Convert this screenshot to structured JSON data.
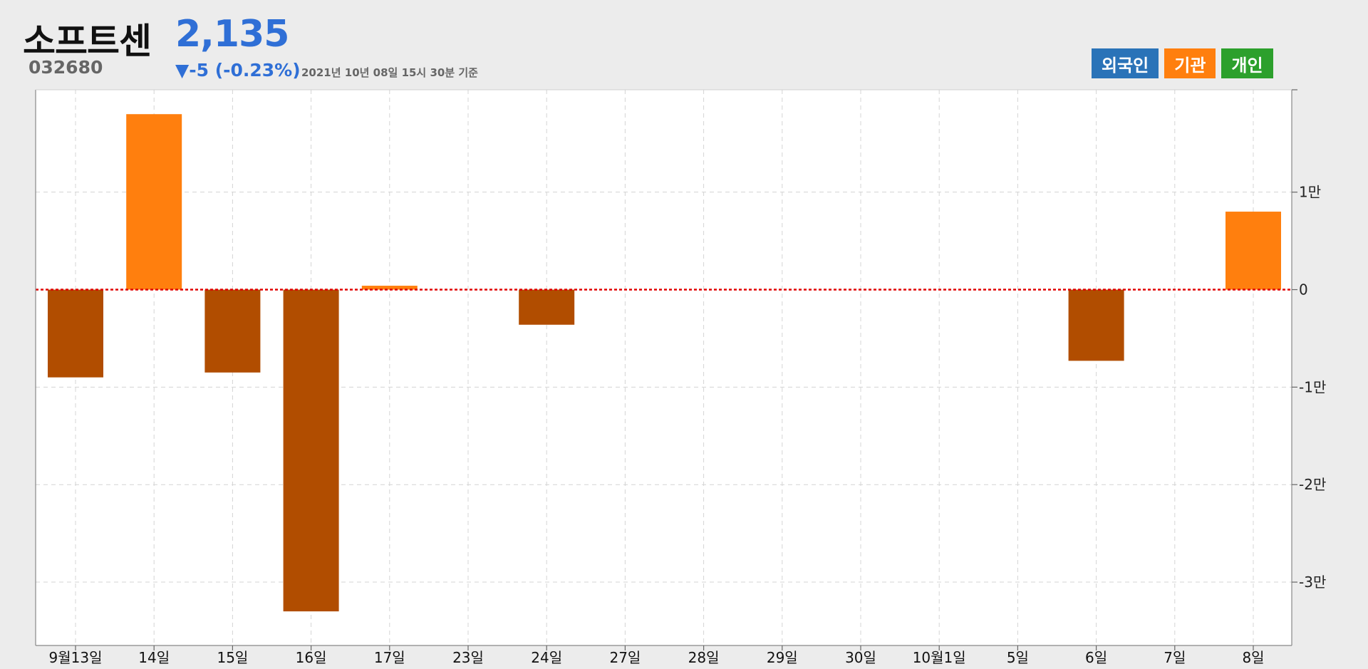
{
  "header": {
    "name": "소프트센",
    "code": "032680",
    "price": "2,135",
    "change": "▼-5 (-0.23%)",
    "timestamp": "2021년 10년 08일 15시 30분 기준"
  },
  "legend": {
    "foreign": {
      "label": "외국인",
      "color": "#2a73b8"
    },
    "institution": {
      "label": "기관",
      "color": "#ff7f0e"
    },
    "individual": {
      "label": "개인",
      "color": "#2ca02c"
    }
  },
  "chart_data": {
    "type": "bar",
    "categories": [
      "9월13일",
      "14일",
      "15일",
      "16일",
      "17일",
      "23일",
      "24일",
      "27일",
      "28일",
      "29일",
      "30일",
      "10월1일",
      "5일",
      "6일",
      "7일",
      "8일"
    ],
    "series": [
      {
        "name": "기관",
        "values": [
          -9000,
          18000,
          -8500,
          -33000,
          400,
          0,
          -3600,
          0,
          0,
          0,
          0,
          0,
          0,
          -7300,
          0,
          8000
        ]
      }
    ],
    "ylim": [
      -36500,
      20500
    ],
    "yticks": [
      10000,
      0,
      -10000,
      -20000,
      -30000
    ],
    "ytick_labels": [
      "1만",
      "0",
      "-1만",
      "-2만",
      "-3만"
    ],
    "grid": true,
    "zero_line_color": "#e00000",
    "positive_color": "#ff7f0e",
    "negative_color": "#b14d00"
  }
}
